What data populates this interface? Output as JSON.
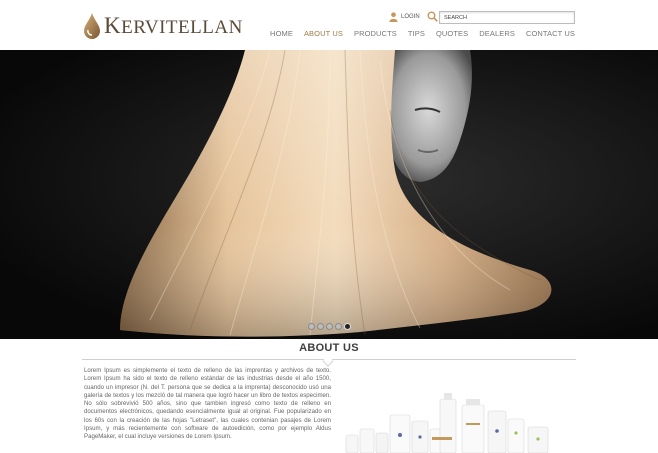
{
  "brand": {
    "name": "Kervitellan",
    "first_letter": "K",
    "rest": "ERVITELLAN"
  },
  "header": {
    "login_label": "LOGIN",
    "search_placeholder": "SEARCH"
  },
  "nav": {
    "items": [
      {
        "label": "HOME",
        "active": false
      },
      {
        "label": "ABOUT US",
        "active": true
      },
      {
        "label": "PRODUCTS",
        "active": false
      },
      {
        "label": "TIPS",
        "active": false
      },
      {
        "label": "QUOTES",
        "active": false
      },
      {
        "label": "DEALERS",
        "active": false
      },
      {
        "label": "CONTACT US",
        "active": false
      }
    ]
  },
  "slider": {
    "dot_count": 5,
    "active_index": 4
  },
  "about": {
    "title": "ABOUT US",
    "body": "Lorem Ipsum es simplemente el texto de relleno de las imprentas y archivos de texto. Lorem Ipsum ha sido el texto de relleno estándar de las industrias desde el año 1500, cuando un impresor (N. del T. persona que se dedica a la imprenta) desconocido usó una galería de textos y los mezcló de tal manera que logró hacer un libro de textos especimen. No sólo sobrevivió 500 años, sino que tambien ingresó como texto de relleno en documentos electrónicos, quedando esencialmente igual al original. Fue popularizado en los 60s con la creación de las hojas \"Letraset\", las cuales contenian pasajes de Lorem Ipsum, y más recientemente con software de autoedición, como por ejemplo Aldus PageMaker, el cual incluye versiones de Lorem Ipsum."
  },
  "colors": {
    "accent": "#a07a45",
    "nav_text": "#777777",
    "brand_dark": "#5a4a38"
  }
}
